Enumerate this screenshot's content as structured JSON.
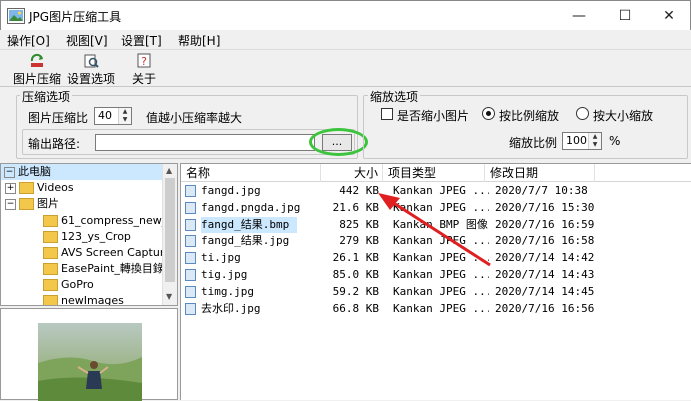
{
  "window": {
    "title": "JPG图片压缩工具",
    "min_symbol": "—",
    "max_symbol": "☐",
    "close_symbol": "✕"
  },
  "menu": [
    "操作[O]",
    "视图[V]",
    "设置[T]",
    "帮助[H]"
  ],
  "toolbar": {
    "compress": "图片压缩",
    "settings": "设置选项",
    "about": "关于"
  },
  "compress_options": {
    "title": "压缩选项",
    "ratio_label": "图片压缩比",
    "ratio_value": "40",
    "ratio_hint": "值越小压缩率越大",
    "output_label": "输出路径:",
    "output_value": "",
    "browse_label": "..."
  },
  "scale_options": {
    "title": "缩放选项",
    "shrink_label": "是否缩小图片",
    "shrink_checked": false,
    "by_ratio_label": "按比例缩放",
    "by_size_label": "按大小缩放",
    "selected": "by_ratio",
    "scale_label": "缩放比例",
    "scale_value": "100",
    "percent": "%"
  },
  "tree": {
    "items": [
      {
        "label": "此电脑",
        "expander": "−"
      },
      {
        "label": "Videos",
        "expander": "+"
      },
      {
        "label": "图片",
        "expander": "−"
      },
      {
        "label": "61_compress_new_合"
      },
      {
        "label": "123_ys_Crop"
      },
      {
        "label": "AVS Screen Captur"
      },
      {
        "label": "EasePaint_轉換目錄"
      },
      {
        "label": "GoPro"
      },
      {
        "label": "newImages"
      }
    ]
  },
  "list": {
    "columns": [
      "名称",
      "大小",
      "项目类型",
      "修改日期"
    ],
    "rows": [
      {
        "name": "fangd.jpg",
        "size": "442 KB",
        "type": "Kankan JPEG ...",
        "date": "2020/7/7 10:38",
        "selected": false
      },
      {
        "name": "fangd.pngda.jpg",
        "size": "21.6 KB",
        "type": "Kankan JPEG ...",
        "date": "2020/7/16 15:30",
        "selected": false
      },
      {
        "name": "fangd_结果.bmp",
        "size": "825 KB",
        "type": "Kankan BMP 图像",
        "date": "2020/7/16 16:59",
        "selected": true
      },
      {
        "name": "fangd_结果.jpg",
        "size": "279 KB",
        "type": "Kankan JPEG ...",
        "date": "2020/7/16 16:58",
        "selected": false
      },
      {
        "name": "ti.jpg",
        "size": "26.1 KB",
        "type": "Kankan JPEG ...",
        "date": "2020/7/14 14:42",
        "selected": false
      },
      {
        "name": "tig.jpg",
        "size": "85.0 KB",
        "type": "Kankan JPEG ...",
        "date": "2020/7/14 14:43",
        "selected": false
      },
      {
        "name": "timg.jpg",
        "size": "59.2 KB",
        "type": "Kankan JPEG ...",
        "date": "2020/7/14 14:45",
        "selected": false
      },
      {
        "name": "去水印.jpg",
        "size": "66.8 KB",
        "type": "Kankan JPEG ...",
        "date": "2020/7/16 16:56",
        "selected": false
      }
    ]
  },
  "colors": {
    "selection": "#cce8ff",
    "annotation_green": "#3cc43c",
    "annotation_red": "#e02020"
  }
}
